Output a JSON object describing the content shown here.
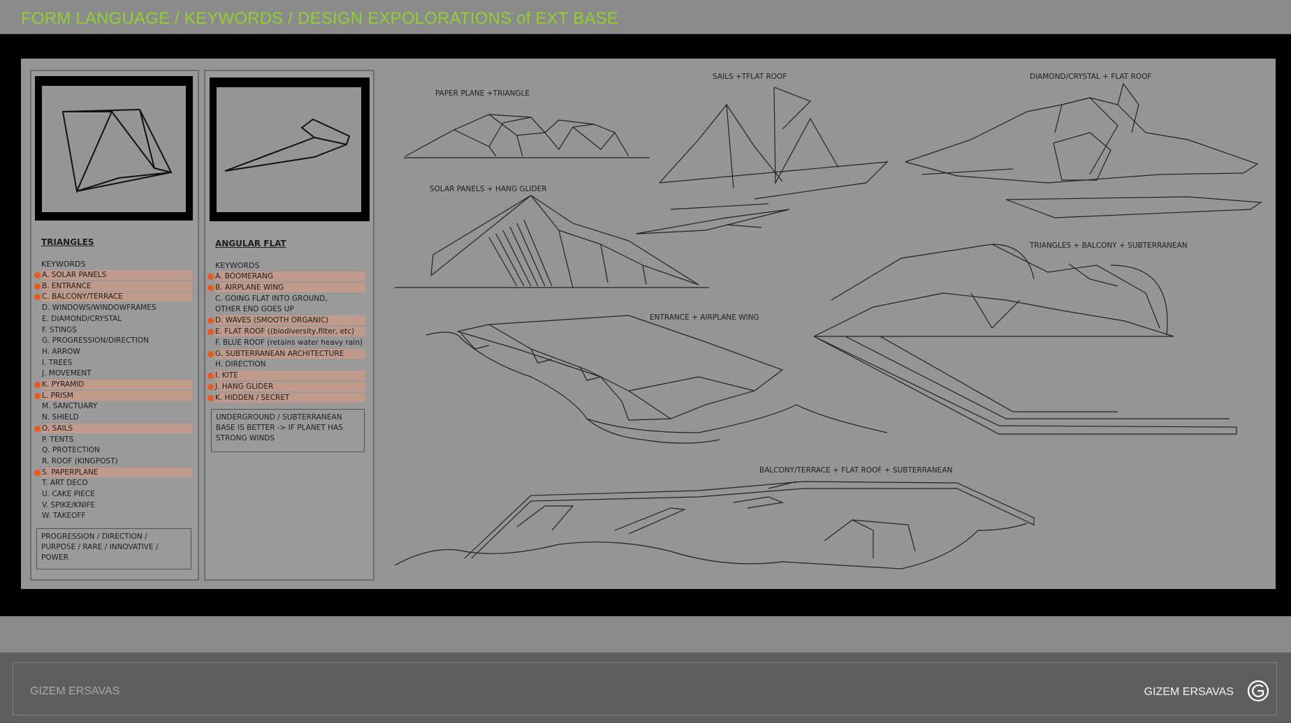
{
  "header": {
    "title": "FORM LANGUAGE / KEYWORDS / DESIGN EXPOLORATIONS of EXT BASE"
  },
  "triangles_panel": {
    "title": "TRIANGLES",
    "keywords_label": "KEYWORDS",
    "items": [
      {
        "text": "A. SOLAR PANELS",
        "hl": true
      },
      {
        "text": "B. ENTRANCE",
        "hl": true
      },
      {
        "text": "C. BALCONY/TERRACE",
        "hl": true
      },
      {
        "text": "D. WINDOWS/WINDOWFRAMES",
        "hl": false
      },
      {
        "text": "E. DIAMOND/CRYSTAL",
        "hl": false
      },
      {
        "text": "F. STINGS",
        "hl": false
      },
      {
        "text": "G. PROGRESSION/DIRECTION",
        "hl": false
      },
      {
        "text": "H. ARROW",
        "hl": false
      },
      {
        "text": "I. TREES",
        "hl": false
      },
      {
        "text": "J. MOVEMENT",
        "hl": false
      },
      {
        "text": "K. PYRAMID",
        "hl": true
      },
      {
        "text": "L. PRISM",
        "hl": true
      },
      {
        "text": "M. SANCTUARY",
        "hl": false
      },
      {
        "text": "N. SHIELD",
        "hl": false
      },
      {
        "text": "O. SAILS",
        "hl": true
      },
      {
        "text": "P. TENTS",
        "hl": false
      },
      {
        "text": "Q. PROTECTION",
        "hl": false
      },
      {
        "text": "R. ROOF (KINGPOST)",
        "hl": false
      },
      {
        "text": "S. PAPERPLANE",
        "hl": true
      },
      {
        "text": "T. ART DECO",
        "hl": false
      },
      {
        "text": "U. CAKE PIECE",
        "hl": false
      },
      {
        "text": "V. SPIKE/KNIFE",
        "hl": false
      },
      {
        "text": "W. TAKEOFF",
        "hl": false
      }
    ],
    "note_lines": [
      "PROGRESSION / DIRECTION /",
      "PURPOSE / RARE / INNOVATIVE /",
      "POWER"
    ]
  },
  "angular_panel": {
    "title": "ANGULAR FLAT",
    "keywords_label": "KEYWORDS",
    "items": [
      {
        "text": "A. BOOMERANG",
        "hl": true
      },
      {
        "text": "B. AIRPLANE WING",
        "hl": true
      },
      {
        "text": "C. GOING FLAT INTO GROUND,",
        "hl": false
      },
      {
        "text": "OTHER END GOES UP",
        "hl": false
      },
      {
        "text": "D. WAVES (SMOOTH ORGANIC)",
        "hl": true
      },
      {
        "text": "E. FLAT ROOF ((biodiversity,filter, etc)",
        "hl": true
      },
      {
        "text": "F. BLUE ROOF (retains water heavy rain)",
        "hl": false
      },
      {
        "text": "G. SUBTERRANEAN ARCHITECTURE",
        "hl": true
      },
      {
        "text": "H. DIRECTION",
        "hl": false
      },
      {
        "text": "I. KITE",
        "hl": true
      },
      {
        "text": "J. HANG GLIDER",
        "hl": true
      },
      {
        "text": "K. HIDDEN / SECRET",
        "hl": true
      }
    ],
    "note_lines": [
      "UNDERGROUND / SUBTERRANEAN",
      "BASE IS BETTER -> IF PLANET HAS",
      "STRONG WINDS"
    ]
  },
  "sketch_labels": {
    "paper_plane": "PAPER PLANE +TRIANGLE",
    "sails": "SAILS +TFLAT ROOF",
    "diamond": "DIAMOND/CRYSTAL + FLAT ROOF",
    "solar": "SOLAR PANELS + HANG GLIDER",
    "triangles_balcony": "TRIANGLES + BALCONY + SUBTERRANEAN",
    "entrance": "ENTRANCE + AIRPLANE WING",
    "balcony": "BALCONY/TERRACE + FLAT ROOF + SUBTERRANEAN"
  },
  "footer": {
    "author": "GIZEM ERSAVAS",
    "brand": "GIZEM ERSAVAS"
  },
  "colors": {
    "title_green": "#8fd12d",
    "highlight": "#c09a8a",
    "dot": "#f0581a"
  }
}
